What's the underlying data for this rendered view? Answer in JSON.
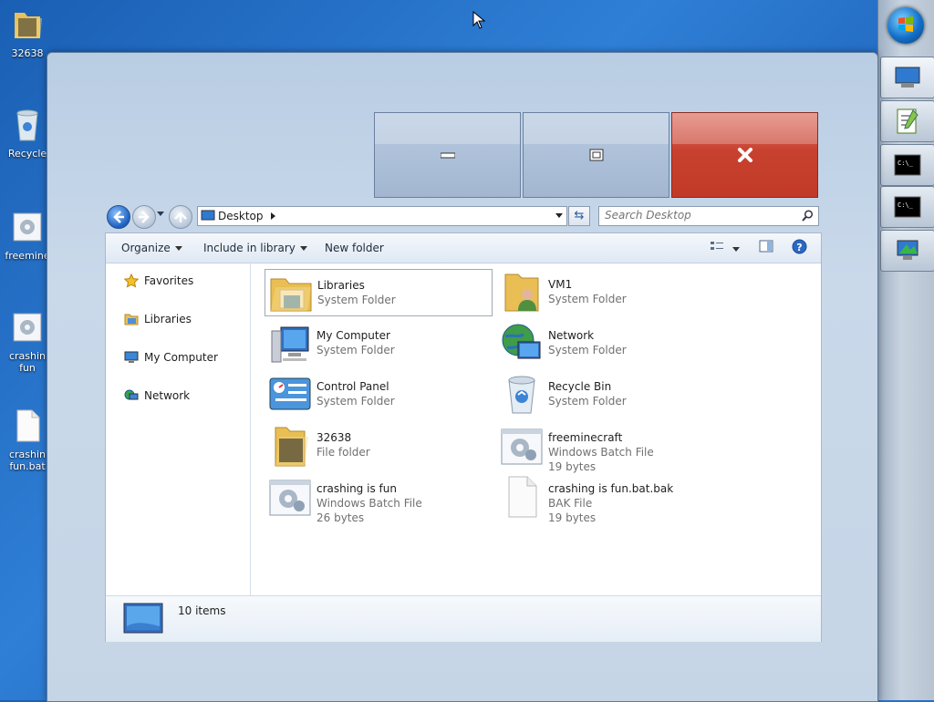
{
  "desktop": {
    "icons": [
      {
        "label": "32638",
        "icon": "folder-icon"
      },
      {
        "label": "Recycle",
        "icon": "recycle-bin-icon"
      },
      {
        "label": "freemine",
        "icon": "batch-file-icon"
      },
      {
        "label": "crashin",
        "label2": "fun",
        "icon": "batch-file-icon"
      },
      {
        "label": "crashin",
        "label2": "fun.bat",
        "icon": "blank-file-icon"
      }
    ]
  },
  "taskbar": {
    "items": [
      "start-orb",
      "computer-icon",
      "notepad-plus-icon",
      "cmd-icon",
      "cmd-icon",
      "network-icon"
    ]
  },
  "window": {
    "caption": {
      "minimize": "minimize",
      "maximize": "maximize",
      "close": "close"
    },
    "address": {
      "location": "Desktop"
    },
    "search": {
      "placeholder": "Search Desktop"
    },
    "toolbar": {
      "organize": "Organize",
      "include": "Include in library",
      "new_folder": "New folder"
    },
    "nav": [
      {
        "label": "Favorites"
      },
      {
        "label": "Libraries"
      },
      {
        "label": "My Computer"
      },
      {
        "label": "Network"
      }
    ],
    "items": [
      {
        "name": "Libraries",
        "type": "System Folder",
        "size": ""
      },
      {
        "name": "VM1",
        "type": "System Folder",
        "size": ""
      },
      {
        "name": "My Computer",
        "type": "System Folder",
        "size": ""
      },
      {
        "name": "Network",
        "type": "System Folder",
        "size": ""
      },
      {
        "name": "Control Panel",
        "type": "System Folder",
        "size": ""
      },
      {
        "name": "Recycle Bin",
        "type": "System Folder",
        "size": ""
      },
      {
        "name": "32638",
        "type": "File folder",
        "size": ""
      },
      {
        "name": "freeminecraft",
        "type": "Windows Batch File",
        "size": "19 bytes"
      },
      {
        "name": "crashing is fun",
        "type": "Windows Batch File",
        "size": "26 bytes"
      },
      {
        "name": "crashing is fun.bat.bak",
        "type": "BAK File",
        "size": "19 bytes"
      }
    ],
    "status": {
      "count": "10 items"
    }
  }
}
